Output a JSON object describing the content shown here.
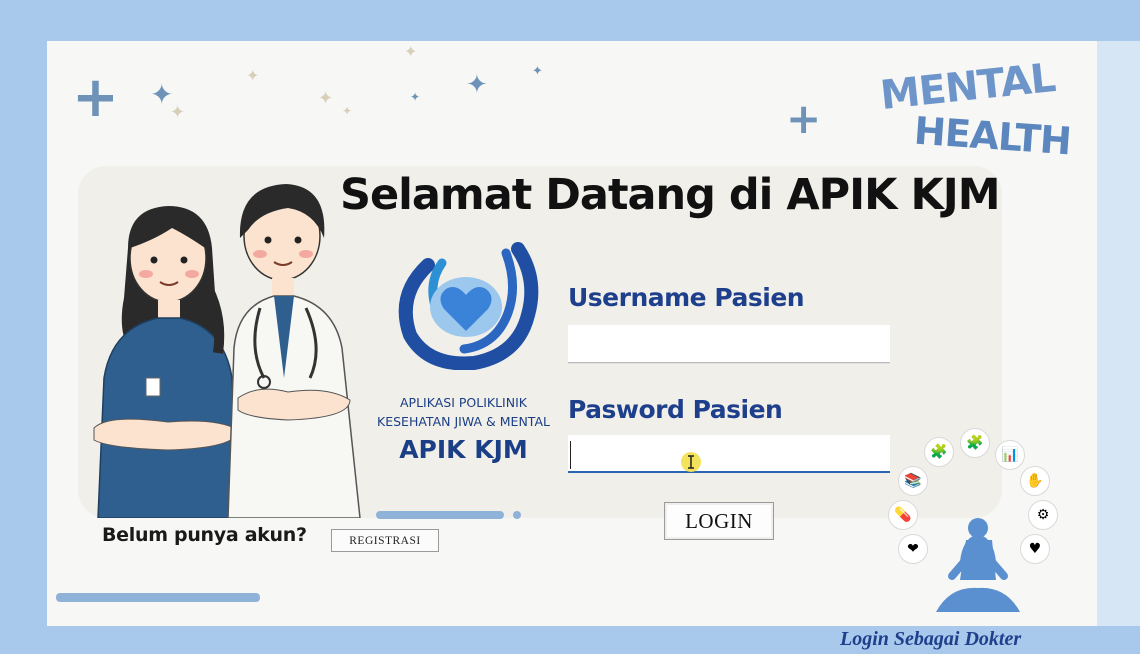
{
  "title": "Selamat Datang di APIK KJM",
  "badge": {
    "line1": "MENTAL",
    "line2": "HEALTH"
  },
  "logo": {
    "line1": "APLIKASI POLIKLINIK",
    "line2": "KESEHATAN JIWA & MENTAL",
    "name": "APIK KJM"
  },
  "form": {
    "username_label": "Username Pasien",
    "username_value": "",
    "password_label": "Pasword Pasien",
    "password_value": "",
    "login_label": "LOGIN"
  },
  "register": {
    "prompt": "Belum punya akun?",
    "button_label": "REGISTRASI"
  },
  "doctor_link": "Login Sebagai Dokter",
  "colors": {
    "primary_blue": "#1e3f8c",
    "accent_blue": "#2b66b2",
    "background": "#a9c9ec"
  }
}
